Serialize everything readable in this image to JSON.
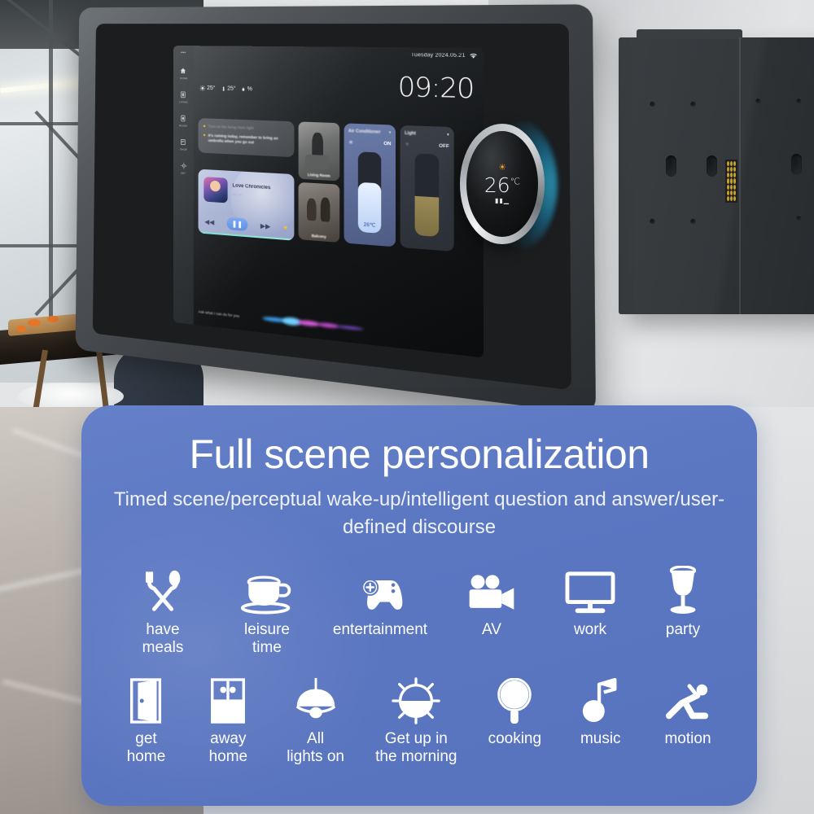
{
  "device": {
    "screen": {
      "statusbar": {
        "date": "Tuesday 2024.05.21",
        "wifi_icon": "wifi-icon"
      },
      "clock": "09:20",
      "weather": [
        {
          "icon": "sun-icon",
          "value": "25°"
        },
        {
          "icon": "thermometer-icon",
          "value": "25°"
        },
        {
          "icon": "humidity-icon",
          "value": "%"
        }
      ],
      "sidebar": {
        "menu_icon": "menu-dots-icon",
        "items": [
          {
            "icon": "home-icon",
            "label": "HOME"
          },
          {
            "icon": "room-icon",
            "label": "LIVING"
          },
          {
            "icon": "device-icon",
            "label": "ROOM"
          },
          {
            "icon": "scene-icon",
            "label": "SHOP"
          },
          {
            "icon": "settings-icon",
            "label": "SET"
          }
        ]
      },
      "voice_card": {
        "lines": [
          {
            "pin": "pin-icon",
            "text": "Turn on the living room light"
          },
          {
            "pin": "pin-icon",
            "text": "It's raining today, remember to bring an umbrella when you go out"
          }
        ]
      },
      "music": {
        "title": "Love Chronicles",
        "artist": "",
        "prev_icon": "skip-previous-icon",
        "play_icon": "pause-icon",
        "next_icon": "skip-next-icon",
        "like_icon": "heart-icon"
      },
      "cameras": [
        {
          "label": "Living Room"
        },
        {
          "label": "Balcony"
        }
      ],
      "sliders": [
        {
          "name": "Air Conditioner",
          "icon": "snowflake-icon",
          "state": "ON",
          "value": "26℃",
          "chevron": "chevron-down-icon"
        },
        {
          "name": "Light",
          "icon": "bulb-icon",
          "state": "OFF",
          "value": "",
          "chevron": "chevron-down-icon"
        }
      ],
      "voice_prompt": "Ask what I can do for you"
    },
    "knob": {
      "mode_icon": "sun-icon",
      "temperature": "26",
      "unit": "℃",
      "signal_icon": "signal-icon"
    }
  },
  "panel": {
    "headline": "Full scene personalization",
    "subtitle": "Timed scene/perceptual wake-up/intelligent question and answer/user-defined discourse",
    "accent_color": "#5b77c2",
    "scenes_row1": [
      {
        "icon": "cutlery-icon",
        "label": "have\nmeals"
      },
      {
        "icon": "teacup-icon",
        "label": "leisure\ntime"
      },
      {
        "icon": "gamepad-icon",
        "label": "entertainment"
      },
      {
        "icon": "video-camera-icon",
        "label": "AV"
      },
      {
        "icon": "monitor-icon",
        "label": "work"
      },
      {
        "icon": "wine-glass-icon",
        "label": "party"
      }
    ],
    "scenes_row2": [
      {
        "icon": "open-door-icon",
        "label": "get\nhome"
      },
      {
        "icon": "window-icon",
        "label": "away\nhome"
      },
      {
        "icon": "pendant-lamp-icon",
        "label": "All\nlights on"
      },
      {
        "icon": "sunrise-icon",
        "label": "Get up in\nthe morning"
      },
      {
        "icon": "frying-pan-icon",
        "label": "cooking"
      },
      {
        "icon": "music-note-icon",
        "label": "music"
      },
      {
        "icon": "running-person-icon",
        "label": "motion"
      }
    ]
  }
}
